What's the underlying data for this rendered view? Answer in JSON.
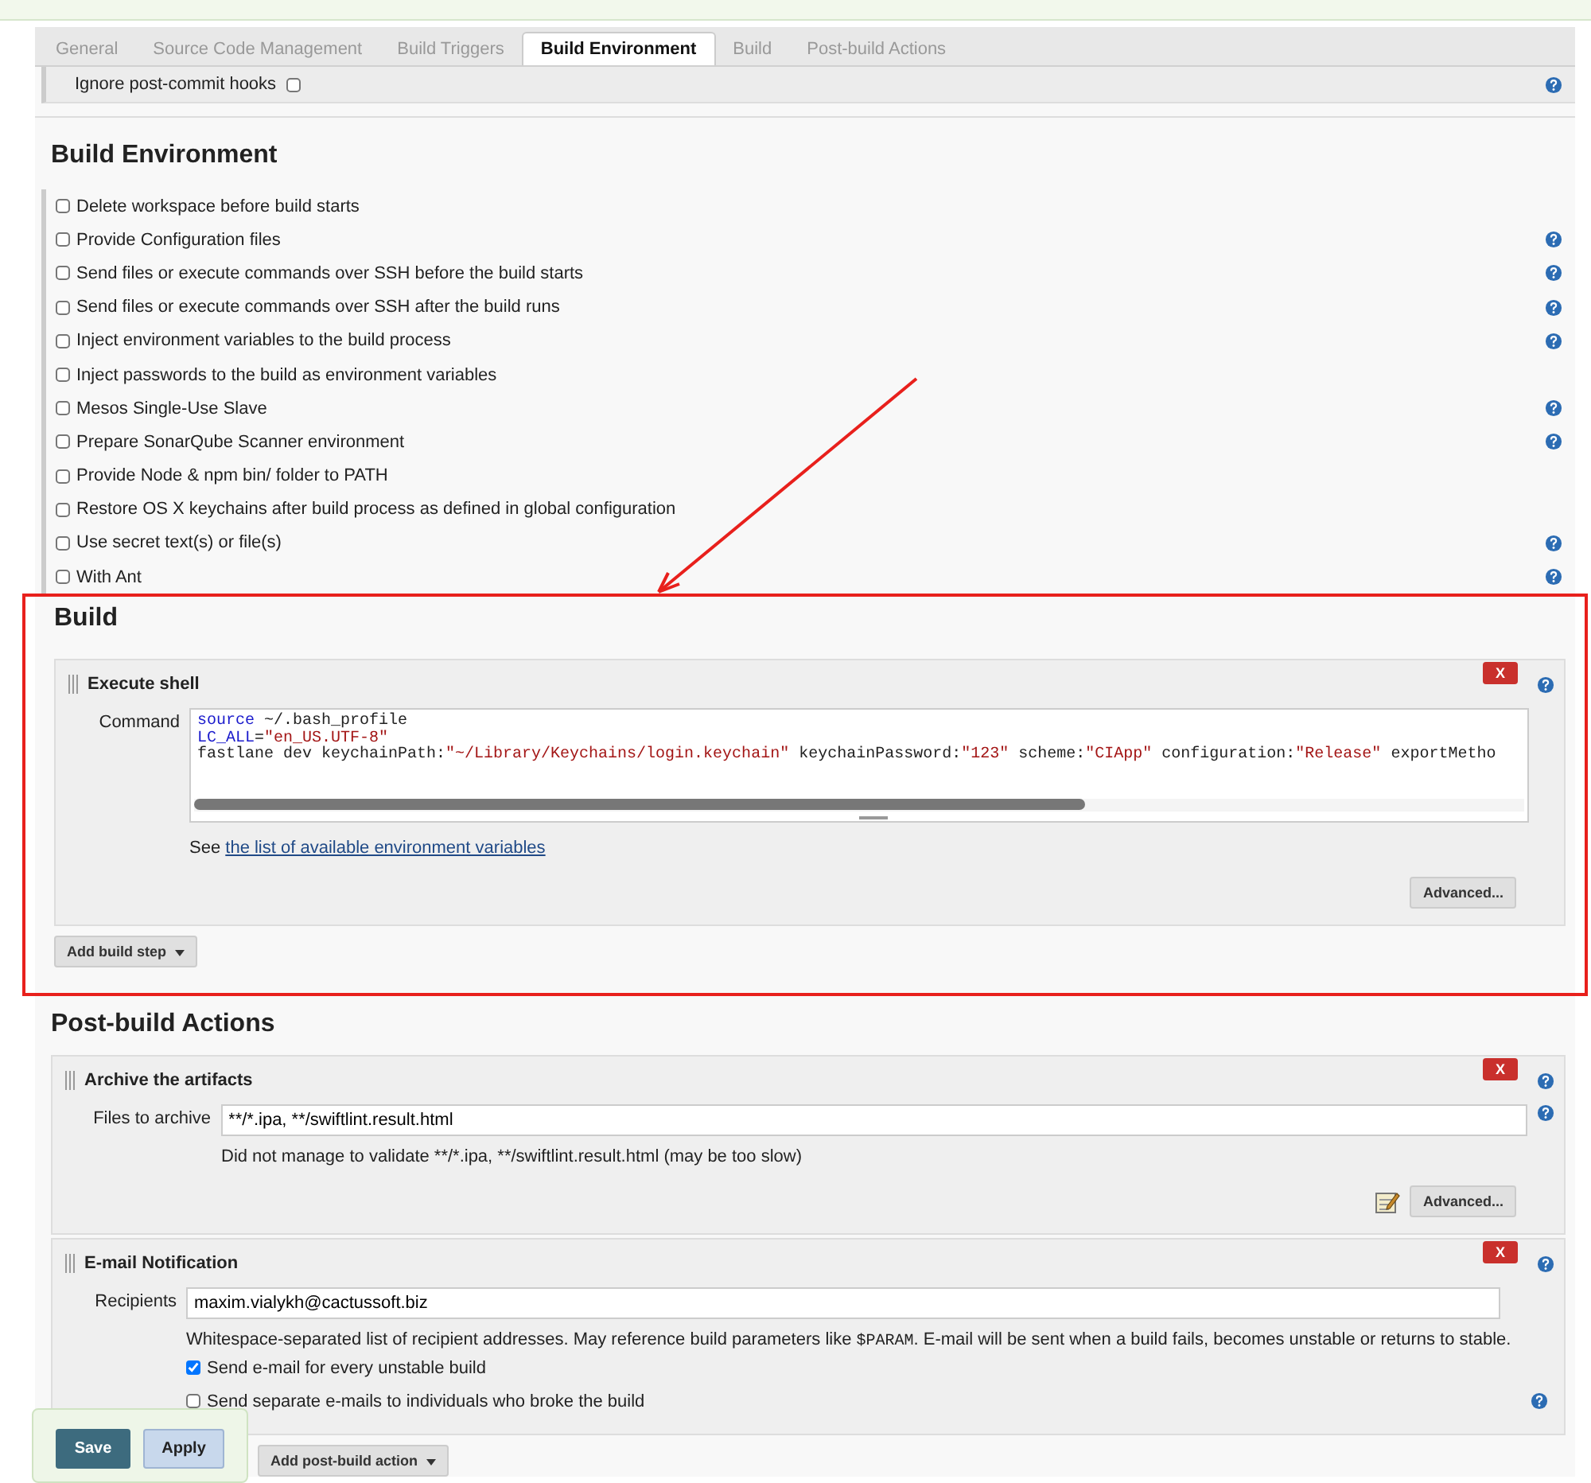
{
  "tabs": [
    {
      "label": "General",
      "selected": false
    },
    {
      "label": "Source Code Management",
      "selected": false
    },
    {
      "label": "Build Triggers",
      "selected": false
    },
    {
      "label": "Build Environment",
      "selected": true
    },
    {
      "label": "Build",
      "selected": false
    },
    {
      "label": "Post-build Actions",
      "selected": false
    }
  ],
  "trigger_option": {
    "label": "Ignore post-commit hooks",
    "checked": false,
    "help": true
  },
  "build_environment": {
    "title": "Build Environment",
    "options": [
      {
        "label": "Delete workspace before build starts",
        "checked": false,
        "help": false
      },
      {
        "label": "Provide Configuration files",
        "checked": false,
        "help": true
      },
      {
        "label": "Send files or execute commands over SSH before the build starts",
        "checked": false,
        "help": true
      },
      {
        "label": "Send files or execute commands over SSH after the build runs",
        "checked": false,
        "help": true
      },
      {
        "label": "Inject environment variables to the build process",
        "checked": false,
        "help": true
      },
      {
        "label": "Inject passwords to the build as environment variables",
        "checked": false,
        "help": false
      },
      {
        "label": "Mesos Single-Use Slave",
        "checked": false,
        "help": true
      },
      {
        "label": "Prepare SonarQube Scanner environment",
        "checked": false,
        "help": true
      },
      {
        "label": "Provide Node & npm bin/ folder to PATH",
        "checked": false,
        "help": false
      },
      {
        "label": "Restore OS X keychains after build process as defined in global configuration",
        "checked": false,
        "help": false
      },
      {
        "label": "Use secret text(s) or file(s)",
        "checked": false,
        "help": true
      },
      {
        "label": "With Ant",
        "checked": false,
        "help": true
      }
    ]
  },
  "build": {
    "title": "Build",
    "highlighted": true,
    "steps": [
      {
        "title": "Execute shell",
        "delete": "X",
        "field_label": "Command",
        "code_lines": [
          [
            {
              "kind": "keyword",
              "text": "source"
            },
            {
              "kind": "plain",
              "text": " ~/.bash_profile"
            }
          ],
          [
            {
              "kind": "keyword",
              "text": "LC_ALL"
            },
            {
              "kind": "plain",
              "text": "="
            },
            {
              "kind": "string",
              "text": "\"en_US.UTF-8\""
            }
          ],
          [
            {
              "kind": "plain",
              "text": "fastlane dev keychainPath:"
            },
            {
              "kind": "string",
              "text": "\"~/Library/Keychains/login.keychain\""
            },
            {
              "kind": "plain",
              "text": " keychainPassword:"
            },
            {
              "kind": "string",
              "text": "\"123\""
            },
            {
              "kind": "plain",
              "text": " scheme:"
            },
            {
              "kind": "string",
              "text": "\"CIApp\""
            },
            {
              "kind": "plain",
              "text": " configuration:"
            },
            {
              "kind": "string",
              "text": "\"Release\""
            },
            {
              "kind": "plain",
              "text": " exportMetho"
            }
          ]
        ],
        "note_prefix": "See",
        "note_link": "the list of available environment variables",
        "advanced": "Advanced..."
      }
    ],
    "add_button": "Add build step"
  },
  "post_build": {
    "title": "Post-build Actions",
    "archive": {
      "title": "Archive the artifacts",
      "delete": "X",
      "field_label": "Files to archive",
      "value": "**/*.ipa, **/swiftlint.result.html",
      "message": "Did not manage to validate **/*.ipa, **/swiftlint.result.html (may be too slow)",
      "advanced": "Advanced..."
    },
    "email": {
      "title": "E-mail Notification",
      "delete": "X",
      "field_label": "Recipients",
      "value": "maxim.vialykh@cactussoft.biz",
      "description": [
        {
          "kind": "plain",
          "text": "Whitespace-separated list of recipient addresses. May reference build parameters like "
        },
        {
          "kind": "code",
          "text": "$PARAM"
        },
        {
          "kind": "plain",
          "text": ". E-mail will be sent when a build fails, becomes unstable or returns to stable."
        }
      ],
      "checks": [
        {
          "label": "Send e-mail for every unstable build",
          "checked": true,
          "help": false
        },
        {
          "label": "Send separate e-mails to individuals who broke the build",
          "checked": false,
          "help": true
        }
      ]
    },
    "add_button": "Add post-build action"
  },
  "save_bar": {
    "save": "Save",
    "apply": "Apply"
  }
}
